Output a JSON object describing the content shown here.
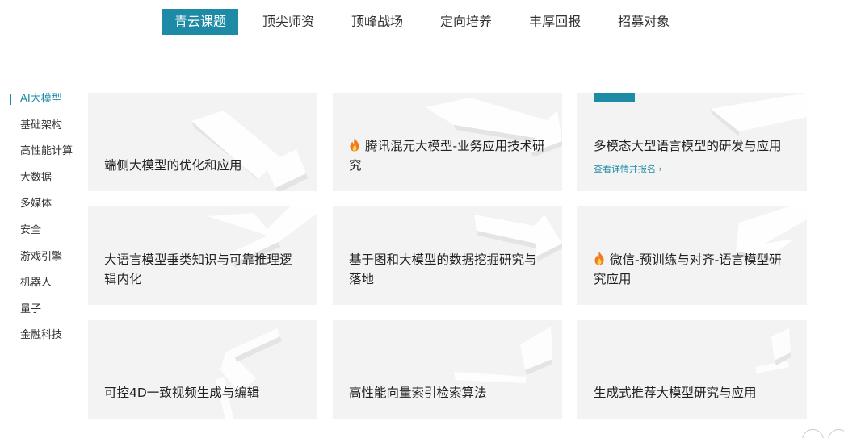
{
  "top_nav": {
    "tabs": [
      {
        "label": "青云课题",
        "active": true
      },
      {
        "label": "顶尖师资",
        "active": false
      },
      {
        "label": "顶峰战场",
        "active": false
      },
      {
        "label": "定向培养",
        "active": false
      },
      {
        "label": "丰厚回报",
        "active": false
      },
      {
        "label": "招募对象",
        "active": false
      }
    ]
  },
  "sidebar": {
    "items": [
      {
        "label": "AI大模型",
        "active": true
      },
      {
        "label": "基础架构",
        "active": false
      },
      {
        "label": "高性能计算",
        "active": false
      },
      {
        "label": "大数据",
        "active": false
      },
      {
        "label": "多媒体",
        "active": false
      },
      {
        "label": "安全",
        "active": false
      },
      {
        "label": "游戏引擎",
        "active": false
      },
      {
        "label": "机器人",
        "active": false
      },
      {
        "label": "量子",
        "active": false
      },
      {
        "label": "金融科技",
        "active": false
      }
    ]
  },
  "cards": [
    {
      "title": "端侧大模型的优化和应用",
      "hot": false
    },
    {
      "title": "腾讯混元大模型-业务应用技术研究",
      "hot": true
    },
    {
      "title": "多模态大型语言模型的研发与应用",
      "hot": false,
      "link": "查看详情并报名 ›",
      "highlighted": true
    },
    {
      "title": "大语言模型垂类知识与可靠推理逻辑内化",
      "hot": false
    },
    {
      "title": "基于图和大模型的数据挖掘研究与落地",
      "hot": false
    },
    {
      "title": "微信-预训练与对齐-语言模型研究应用",
      "hot": true
    },
    {
      "title": "可控4D一致视频生成与编辑",
      "hot": false
    },
    {
      "title": "高性能向量索引检索算法",
      "hot": false
    },
    {
      "title": "生成式推荐大模型研究与应用",
      "hot": false
    }
  ],
  "colors": {
    "accent": "#1d8aa6",
    "card_bg": "#f3f3f3",
    "flame_outer": "#f07a1e",
    "flame_inner": "#fcd34d"
  },
  "icons": {
    "hot": "flame-icon",
    "prev": "prev-arrow-icon",
    "next": "next-arrow-icon"
  }
}
